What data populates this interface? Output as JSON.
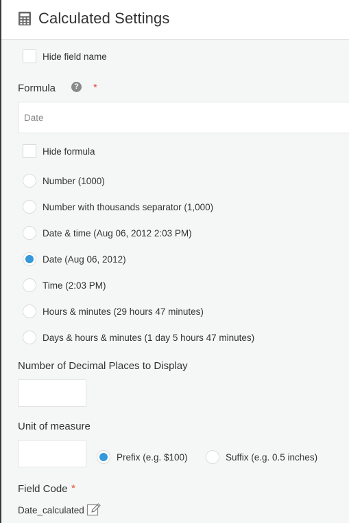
{
  "header": {
    "title": "Calculated Settings",
    "icon": "calculator-icon"
  },
  "hide_field_name": {
    "label": "Hide field name",
    "checked": false
  },
  "formula": {
    "label": "Formula",
    "required_mark": "*",
    "value": "Date"
  },
  "hide_formula": {
    "label": "Hide formula",
    "checked": false
  },
  "format_options": [
    {
      "label": "Number (1000)",
      "selected": false
    },
    {
      "label": "Number with thousands separator (1,000)",
      "selected": false
    },
    {
      "label": "Date & time (Aug 06, 2012 2:03 PM)",
      "selected": false
    },
    {
      "label": "Date (Aug 06, 2012)",
      "selected": true
    },
    {
      "label": "Time (2:03 PM)",
      "selected": false
    },
    {
      "label": "Hours & minutes (29 hours 47 minutes)",
      "selected": false
    },
    {
      "label": "Days & hours & minutes (1 day 5 hours 47 minutes)",
      "selected": false
    }
  ],
  "decimal_places": {
    "label": "Number of Decimal Places to Display",
    "value": ""
  },
  "unit_of_measure": {
    "label": "Unit of measure",
    "value": "",
    "prefix_label": "Prefix (e.g. $100)",
    "suffix_label": "Suffix (e.g. 0.5 inches)",
    "selected": "prefix"
  },
  "field_code": {
    "label": "Field Code",
    "required_mark": "*",
    "value": "Date_calculated"
  },
  "colors": {
    "accent": "#3498db",
    "required": "#e74c3c"
  }
}
